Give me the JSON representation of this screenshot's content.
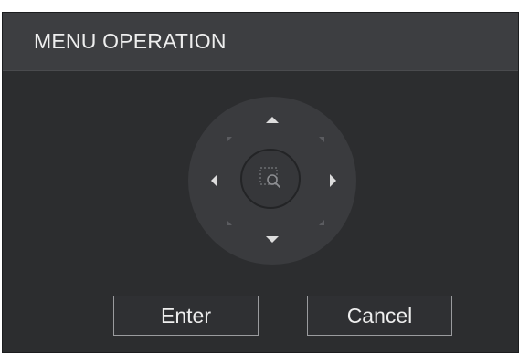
{
  "dialog": {
    "title": "MENU OPERATION",
    "buttons": {
      "enter_label": "Enter",
      "cancel_label": "Cancel"
    },
    "nav_pad": {
      "directions": [
        "up",
        "down",
        "left",
        "right",
        "up-left",
        "up-right",
        "down-left",
        "down-right"
      ],
      "center_icon": "zoom-search-icon",
      "arrow_icons": {
        "up": "chevron-up-icon",
        "down": "chevron-down-icon",
        "left": "chevron-left-icon",
        "right": "chevron-right-icon"
      }
    }
  },
  "colors": {
    "title_bar": "#3d3e41",
    "panel": "#2c2d2f",
    "pad": "#3a3b3e",
    "arrow": "#dddddd",
    "diagonal_marker": "#5b5c60",
    "button_border": "#9a9b9e",
    "text": "#eeeeee"
  }
}
